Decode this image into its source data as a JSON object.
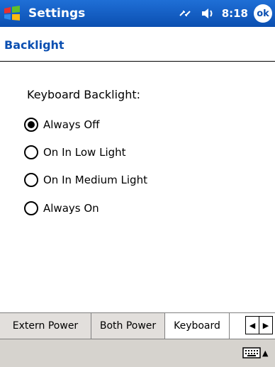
{
  "titlebar": {
    "app_title": "Settings",
    "clock": "8:18",
    "ok_label": "ok"
  },
  "page": {
    "title": "Backlight"
  },
  "backlight": {
    "label": "Keyboard Backlight:",
    "options": [
      {
        "label": "Always Off",
        "checked": true
      },
      {
        "label": "On In Low Light",
        "checked": false
      },
      {
        "label": "On In Medium Light",
        "checked": false
      },
      {
        "label": "Always On",
        "checked": false
      }
    ]
  },
  "tabs": [
    {
      "label": "Extern Power",
      "active": false
    },
    {
      "label": "Both Power",
      "active": false
    },
    {
      "label": "Keyboard",
      "active": true
    }
  ],
  "colors": {
    "title_blue": "#0b4fb1",
    "tab_inactive": "#e2dfdc",
    "bar_gray": "#d6d3ce"
  },
  "icons": {
    "start": "windows-flag-icon",
    "connectivity": "connectivity-icon",
    "volume": "volume-icon",
    "tab_scroll_left": "left-arrow-icon",
    "tab_scroll_right": "right-arrow-icon",
    "sip": "keyboard-icon"
  }
}
